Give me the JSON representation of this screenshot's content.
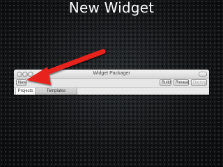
{
  "slide": {
    "title": "New Widget"
  },
  "window": {
    "title": "Widget Packager"
  },
  "toolbar": {
    "new_label": "New",
    "build_label": "Build",
    "reveal_label": "Reveal",
    "deploy_label": "Deploy"
  },
  "tabs": [
    {
      "label": "Projects",
      "active": true
    },
    {
      "label": "Templates",
      "active": false
    }
  ],
  "annotation": {
    "arrow_icon": "red-arrow-icon",
    "arrow_color": "#e8231b"
  }
}
